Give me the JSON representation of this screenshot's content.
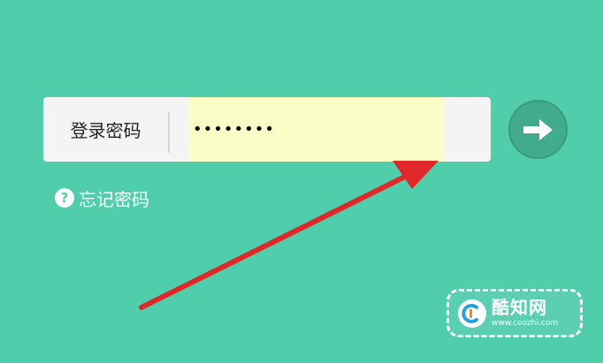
{
  "login": {
    "password_label": "登录密码",
    "password_value": "••••••••",
    "submit_icon": "arrow-right-icon"
  },
  "forgot": {
    "icon": "question-circle-icon",
    "label": "忘记密码"
  },
  "annotation": {
    "icon": "red-arrow-icon",
    "color": "#e0282a"
  },
  "watermark": {
    "name": "酷知网",
    "url": "www.coozhi.com"
  },
  "colors": {
    "background": "#50cdab",
    "input_highlight": "#fbfdc7",
    "button": "#42aa8d"
  }
}
